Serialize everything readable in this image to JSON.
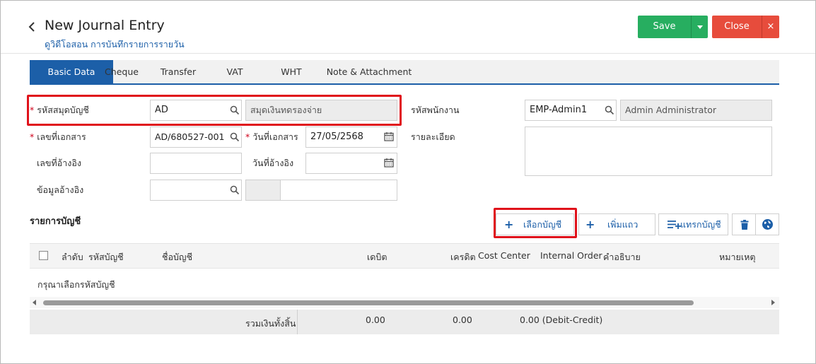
{
  "header": {
    "title": "New Journal Entry",
    "subtitle": "ดูวิดีโอสอน การบันทึกรายการรายวัน",
    "save_label": "Save",
    "close_label": "Close",
    "close_x": "×"
  },
  "tabs": [
    {
      "label": "Basic Data",
      "active": true
    },
    {
      "label": "Cheque"
    },
    {
      "label": "Transfer"
    },
    {
      "label": "VAT"
    },
    {
      "label": "WHT"
    },
    {
      "label": "Note & Attachment"
    }
  ],
  "form": {
    "journal_code_label": "รหัสสมุดบัญชี",
    "journal_code_value": "AD",
    "journal_name_value": "สมุดเงินทดรองจ่าย",
    "doc_no_label": "เลขที่เอกสาร",
    "doc_no_value": "AD/680527-001",
    "doc_date_label": "วันที่เอกสาร",
    "doc_date_value": "27/05/2568",
    "ref_no_label": "เลขที่อ้างอิง",
    "ref_no_value": "",
    "ref_date_label": "วันที่อ้างอิง",
    "ref_date_value": "",
    "ref_info_label": "ข้อมูลอ้างอิง",
    "ref_info_value": "",
    "employee_label": "รหัสพนักงาน",
    "employee_code": "EMP-Admin1",
    "employee_name": "Admin Administrator",
    "detail_label": "รายละเอียด",
    "detail_value": "",
    "required_mark": "*"
  },
  "accounts": {
    "section_title": "รายการบัญชี",
    "select_account_label": "เลือกบัญชี",
    "add_row_label": "เพิ่มแถว",
    "insert_account_label": "แทรกบัญชี",
    "plus": "+",
    "columns": [
      "ลำดับ",
      "รหัสบัญชี",
      "ชื่อบัญชี",
      "เดบิต",
      "เครดิต",
      "Cost Center",
      "Internal Order",
      "คำอธิบาย",
      "หมายเหตุ"
    ],
    "empty_message": "กรุณาเลือกรหัสบัญชี",
    "total_label": "รวมเงินทั้งสิ้น",
    "total_debit": "0.00",
    "total_credit": "0.00",
    "total_diff": "0.00 (Debit-Credit)"
  },
  "colors": {
    "primary": "#1c5fa8",
    "save": "#27ae60",
    "close": "#e74c3c",
    "highlight": "#e0121b"
  },
  "icons": [
    "chevron-left-icon",
    "chevron-down-icon",
    "close-icon",
    "search-icon",
    "calendar-icon",
    "plus-icon",
    "insert-list-icon",
    "trash-icon",
    "globe-icon",
    "checkbox-icon",
    "arrow-left-icon",
    "arrow-right-icon"
  ]
}
